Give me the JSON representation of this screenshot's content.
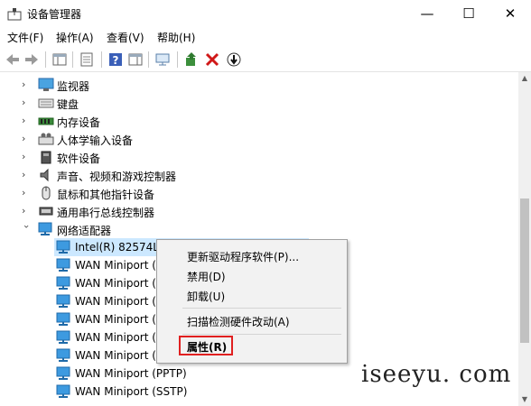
{
  "window": {
    "title": "设备管理器",
    "minimize_label": "—",
    "maximize_label": "☐",
    "close_label": "✕"
  },
  "menu": [
    "文件(F)",
    "操作(A)",
    "查看(V)",
    "帮助(H)"
  ],
  "tree": {
    "categories": [
      {
        "label": "监视器",
        "icon": "monitor-icon"
      },
      {
        "label": "键盘",
        "icon": "keyboard-icon"
      },
      {
        "label": "内存设备",
        "icon": "memory-icon"
      },
      {
        "label": "人体学输入设备",
        "icon": "hid-icon"
      },
      {
        "label": "软件设备",
        "icon": "software-device-icon"
      },
      {
        "label": "声音、视频和游戏控制器",
        "icon": "speaker-icon"
      },
      {
        "label": "鼠标和其他指针设备",
        "icon": "mouse-icon"
      },
      {
        "label": "通用串行总线控制器",
        "icon": "usb-icon"
      },
      {
        "label": "网络适配器",
        "icon": "network-adapter-icon",
        "expanded": true
      }
    ],
    "children": [
      "Intel(R) 82574L",
      "WAN Miniport (",
      "WAN Miniport (",
      "WAN Miniport (",
      "WAN Miniport (",
      "WAN Miniport (",
      "WAN Miniport (",
      "WAN Miniport (PPTP)",
      "WAN Miniport (SSTP)"
    ]
  },
  "context_menu": {
    "update_driver": "更新驱动程序软件(P)...",
    "disable": "禁用(D)",
    "uninstall": "卸载(U)",
    "scan": "扫描检测硬件改动(A)",
    "properties": "属性(R)"
  },
  "watermark": "iseeyu. com",
  "colors": {
    "selection": "#cce8ff",
    "highlight_box": "#e02020",
    "icon_blue": "#2a7fd4"
  }
}
